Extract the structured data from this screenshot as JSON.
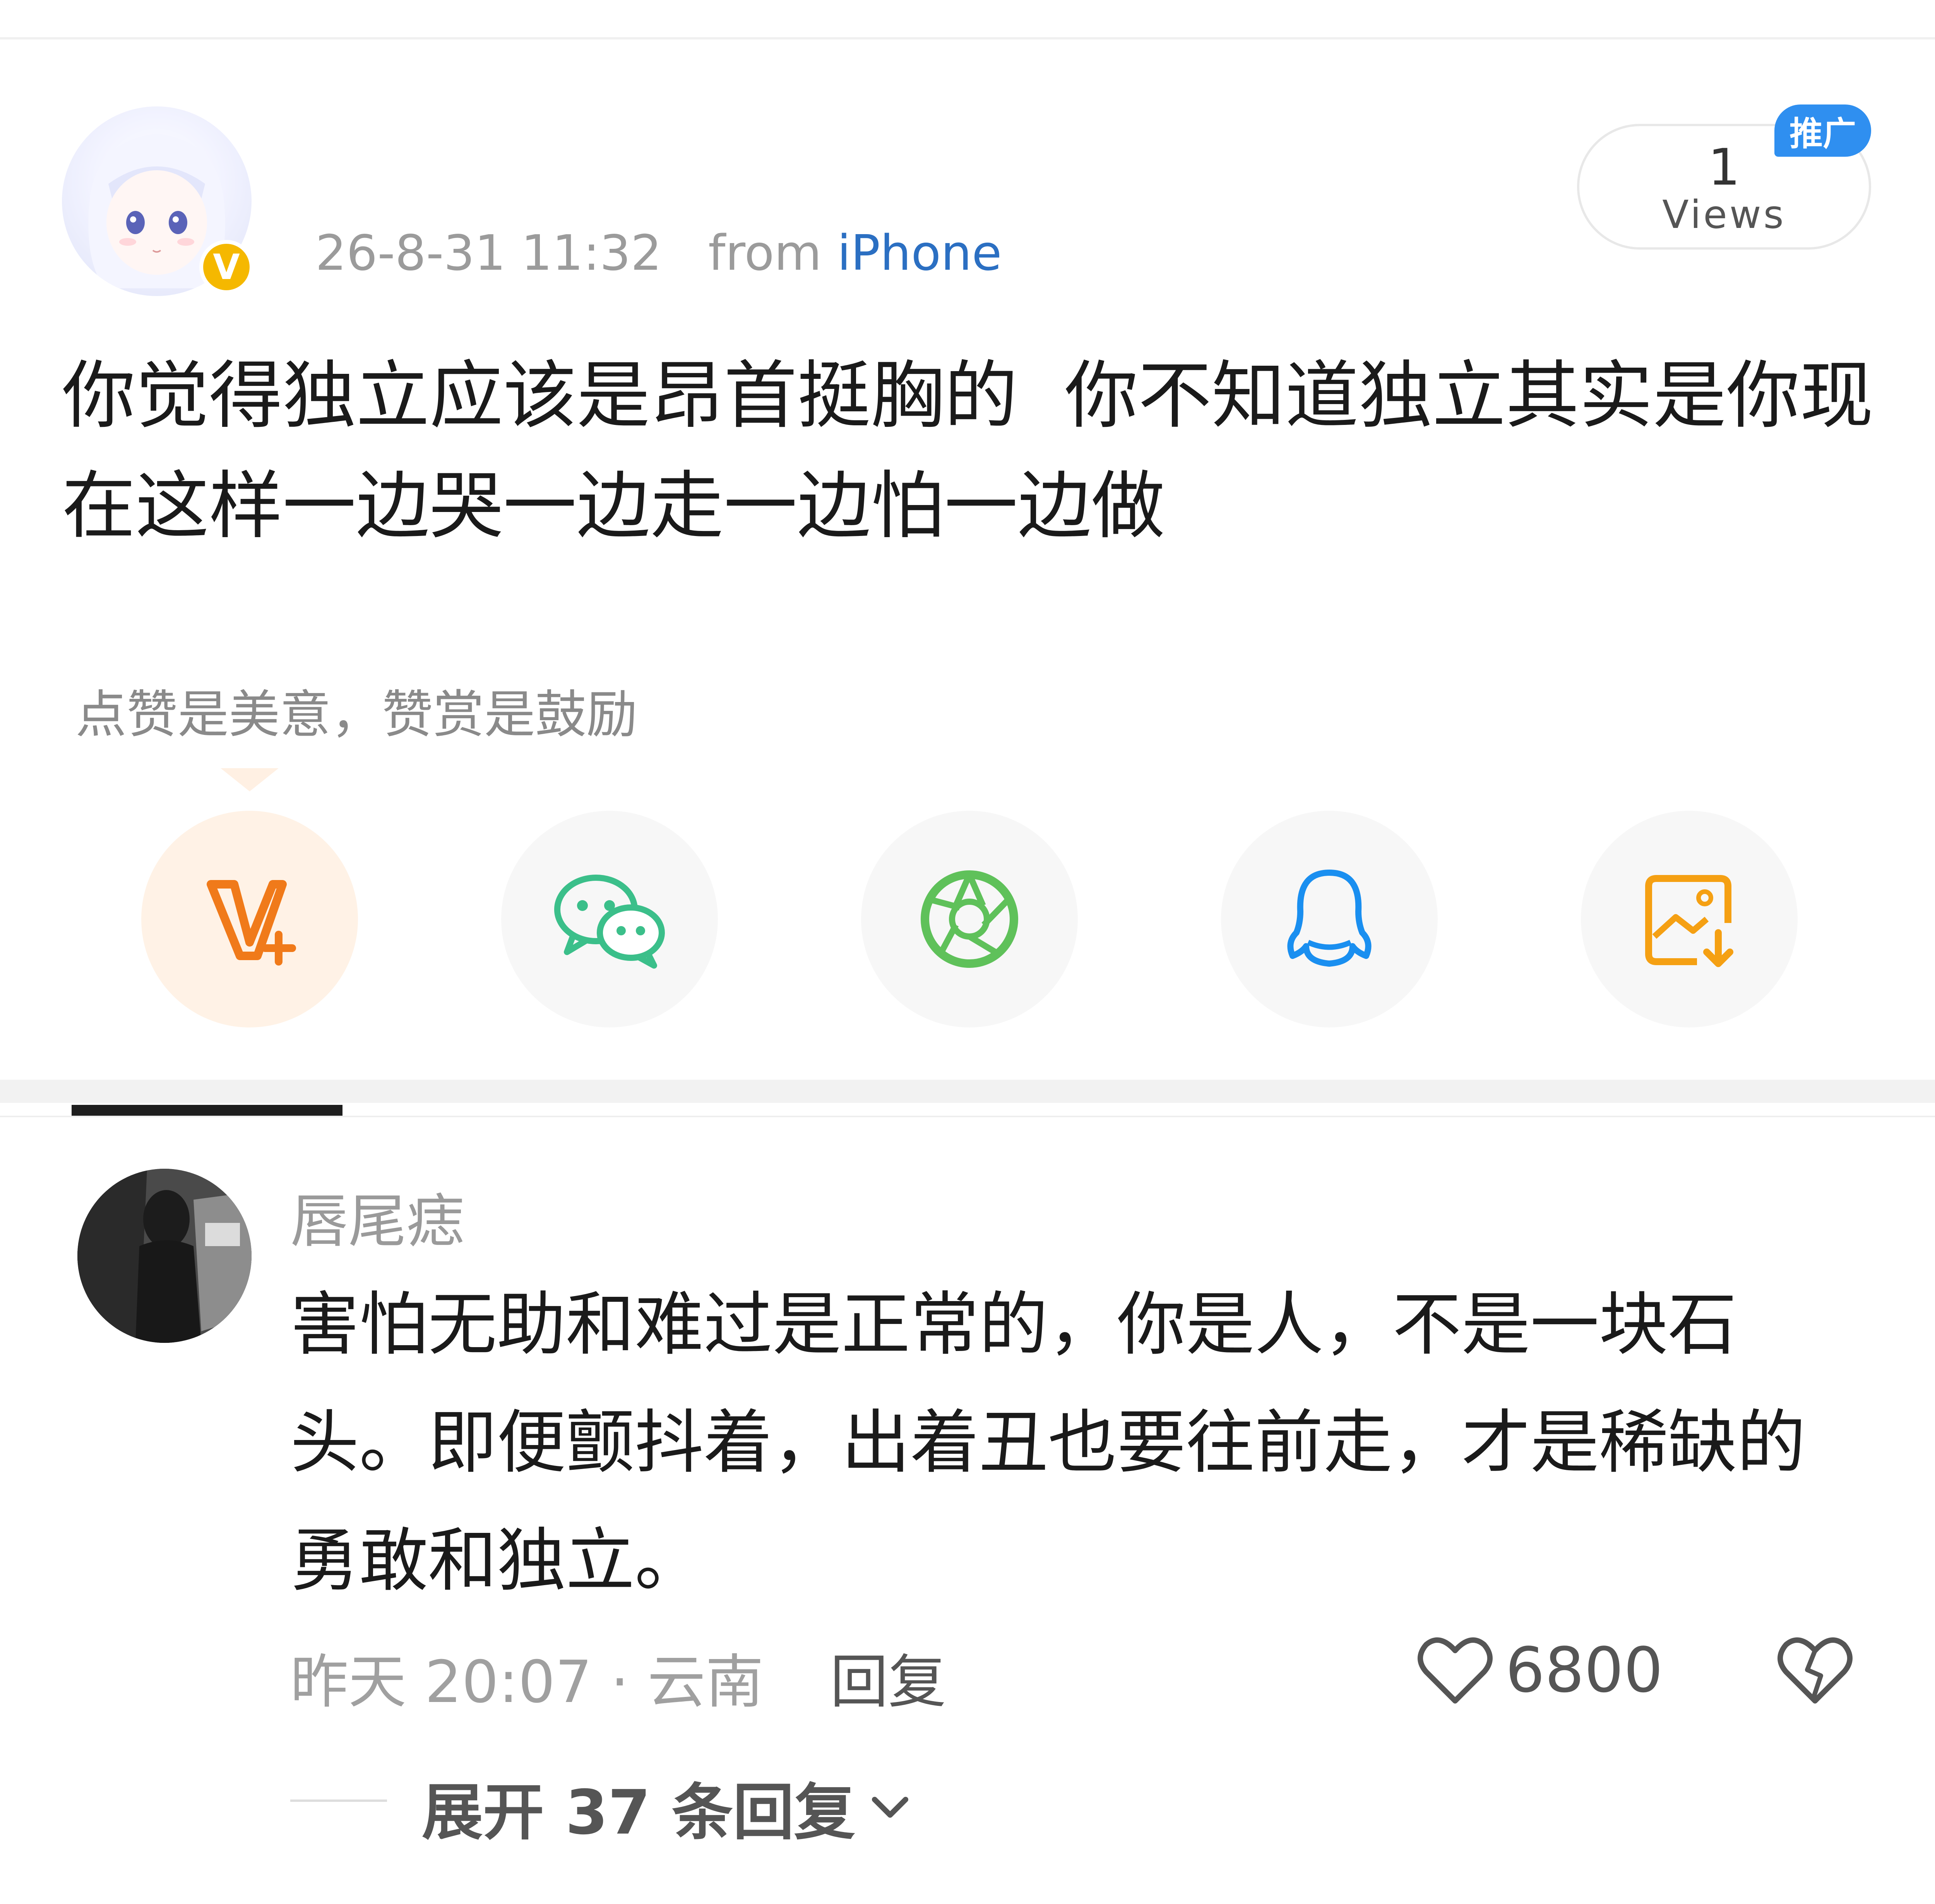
{
  "post": {
    "timestamp": "26-8-31 11:32",
    "from_prefix": "from",
    "device": "iPhone",
    "verified_mark": "V",
    "views": {
      "count": "1",
      "label": "Views"
    },
    "promo_badge": "推广",
    "text_line1": "你觉得独立应该是昂首挺胸的  你不知道独立其实是你现",
    "text_line2": "在这样一边哭一边走一边怕一边做",
    "reward_hint": "点赞是美意，赞赏是鼓励"
  },
  "share": {
    "items": [
      {
        "icon": "vplus-icon",
        "color": "#f07a1a"
      },
      {
        "icon": "wechat-icon",
        "color": "#3bbf8a"
      },
      {
        "icon": "moments-icon",
        "color": "#5fc15a"
      },
      {
        "icon": "qq-icon",
        "color": "#1a8ff0"
      },
      {
        "icon": "save-image-icon",
        "color": "#f5a013"
      }
    ]
  },
  "comment": {
    "author": "唇尾痣",
    "text_line1": "害怕无助和难过是正常的，你是人，不是一块石",
    "text_line2": "头。即便颤抖着，出着丑也要往前走，才是稀缺的",
    "text_line3": "勇敢和独立。",
    "time_location": "昨天 20:07 · 云南",
    "reply_label": "回复",
    "like_count": "6800",
    "expand_label": "展开 37 条回复"
  }
}
